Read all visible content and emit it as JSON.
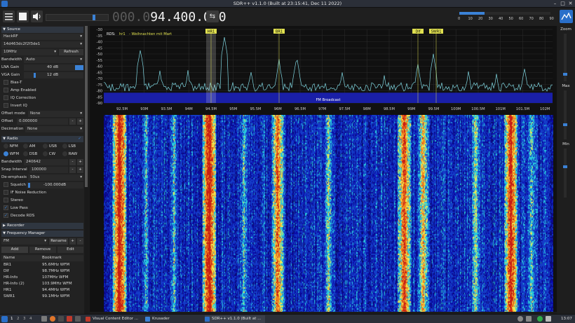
{
  "window": {
    "title": "SDR++ v1.1.0 (Built at 23:15:41, Dec 11 2022)"
  },
  "toolbar": {
    "freq_dim": "000.0",
    "freq_lit": "94.400.000",
    "snr_ticks": [
      "0",
      "10",
      "20",
      "30",
      "40",
      "50",
      "60",
      "70",
      "80",
      "90"
    ],
    "snr_level": 0.28
  },
  "source": {
    "header": "Source",
    "device": "HackRF",
    "serial": "14d463dc2f2f3de1",
    "samplerate": "10MHz",
    "refresh": "Refresh",
    "bandwidth_label": "Bandwidth",
    "bandwidth_value": "Auto",
    "lna_label": "LNA Gain",
    "lna_value": "40 dB",
    "vga_label": "VGA Gain",
    "vga_value": "12 dB",
    "bias_t": "Bias-T",
    "amp": "Amp Enabled",
    "iq_corr": "IQ Correction",
    "invert_iq": "Invert IQ",
    "offset_mode_label": "Offset mode",
    "offset_mode_value": "None",
    "offset_label": "Offset",
    "offset_value": "0.000000",
    "decimation_label": "Decimation",
    "decimation_value": "None"
  },
  "radio": {
    "header": "Radio",
    "modes": [
      "NFM",
      "AM",
      "USB",
      "LSB",
      "WFM",
      "DSB",
      "CW",
      "RAW"
    ],
    "selected_mode": "WFM",
    "bandwidth_label": "Bandwidth",
    "bandwidth_value": "240642",
    "snap_label": "Snap Interval",
    "snap_value": "100000",
    "deemph_label": "De-emphasis",
    "deemph_value": "50us",
    "squelch_label": "Squelch",
    "squelch_value": "-100.000dB",
    "if_nr": "IF Noise Reduction",
    "stereo": "Stereo",
    "low_pass": "Low Pass",
    "decode_rds": "Decode RDS"
  },
  "recorder": {
    "header": "Recorder"
  },
  "freq_manager": {
    "header": "Frequency Manager",
    "list": "FM",
    "rename": "Rename",
    "add": "Add",
    "remove": "Remove",
    "edit": "Edit",
    "col_name": "Name",
    "col_bookmark": "Bookmark",
    "rows": [
      {
        "name": "BR1",
        "bookmark": "95.6MHz WFM"
      },
      {
        "name": "Dlf",
        "bookmark": "98.7MHz WFM"
      },
      {
        "name": "HR-Info",
        "bookmark": "107MHz WFM"
      },
      {
        "name": "HR-Info (2)",
        "bookmark": "103.9MHz WFM"
      },
      {
        "name": "HR1",
        "bookmark": "94.4MHz WFM"
      },
      {
        "name": "SWR1",
        "bookmark": "99.1MHz WFM"
      }
    ]
  },
  "spectrum": {
    "rds_label": "RDS:",
    "rds_ps": "hr1",
    "rds_rt": "- Weihnachten mit Mart",
    "band_label": "FM Broadcast",
    "y_ticks": [
      "-30",
      "-35",
      "-40",
      "-45",
      "-50",
      "-55",
      "-60",
      "-65",
      "-70",
      "-75",
      "-80",
      "-85",
      "-90"
    ],
    "x_ticks": [
      "92.5M",
      "93M",
      "93.5M",
      "94M",
      "94.5M",
      "95M",
      "95.5M",
      "96M",
      "96.5M",
      "97M",
      "97.5M",
      "98M",
      "98.5M",
      "99M",
      "99.5M",
      "100M",
      "100.5M",
      "101M",
      "101.5M",
      "102M"
    ],
    "markers": [
      "HR1",
      "BR1",
      "Dlf",
      "SWR1"
    ]
  },
  "right_panel": {
    "zoom": "Zoom",
    "max": "Max",
    "min": "Min"
  },
  "taskbar": {
    "desktops": [
      "1",
      "2",
      "3",
      "4"
    ],
    "tasks": [
      "Visual Content Editor ...",
      "Krusader",
      "SDR++ v1.1.0 (Built at ..."
    ],
    "clock": "13:07"
  },
  "colors": {
    "accent": "#3b82d6",
    "spectrum_fill": "#1a1fa8",
    "trace": "#7fd6e0",
    "marker": "#e0e050"
  }
}
